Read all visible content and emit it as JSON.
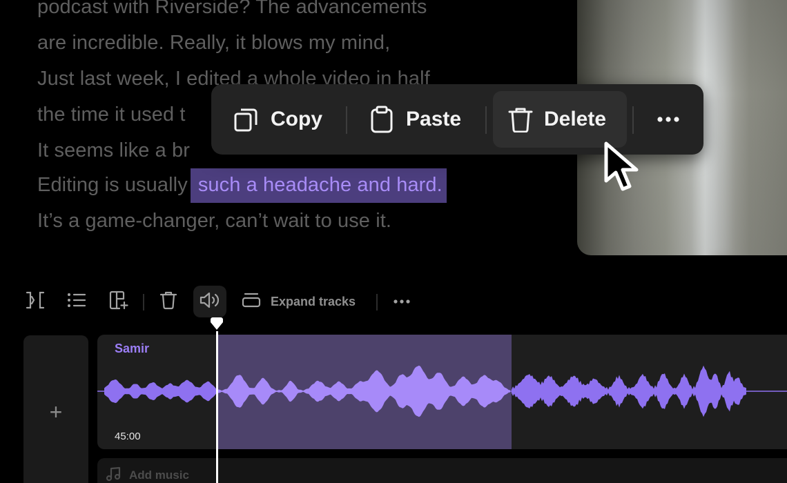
{
  "transcript": {
    "lines": [
      "podcast with Riverside? The advancements",
      "are incredible. Really, it blows my mind,",
      "Just last week, I edited a whole video in half",
      "the time it used t",
      "It seems like a br",
      "Editing is usually",
      "It’s a game-changer, can’t wait to use it."
    ],
    "highlight": "such a headache and hard."
  },
  "context_menu": {
    "copy": "Copy",
    "paste": "Paste",
    "delete": "Delete",
    "more_icon": "ellipsis-icon"
  },
  "toolbar": {
    "split_icon": "split-icon",
    "list_icon": "list-icon",
    "layout_icon": "layout-add-icon",
    "trash_icon": "trash-icon",
    "volume_icon": "volume-icon",
    "expand_label": "Expand tracks",
    "more_icon": "ellipsis-icon"
  },
  "timeline": {
    "add_label": "+",
    "track_name": "Samir",
    "track_time": "45:00",
    "add_music": "Add music"
  },
  "colors": {
    "accent": "#9b7ef5",
    "selection": "#4d426b",
    "highlight_bg": "#4c3e7e",
    "background": "#000000"
  }
}
